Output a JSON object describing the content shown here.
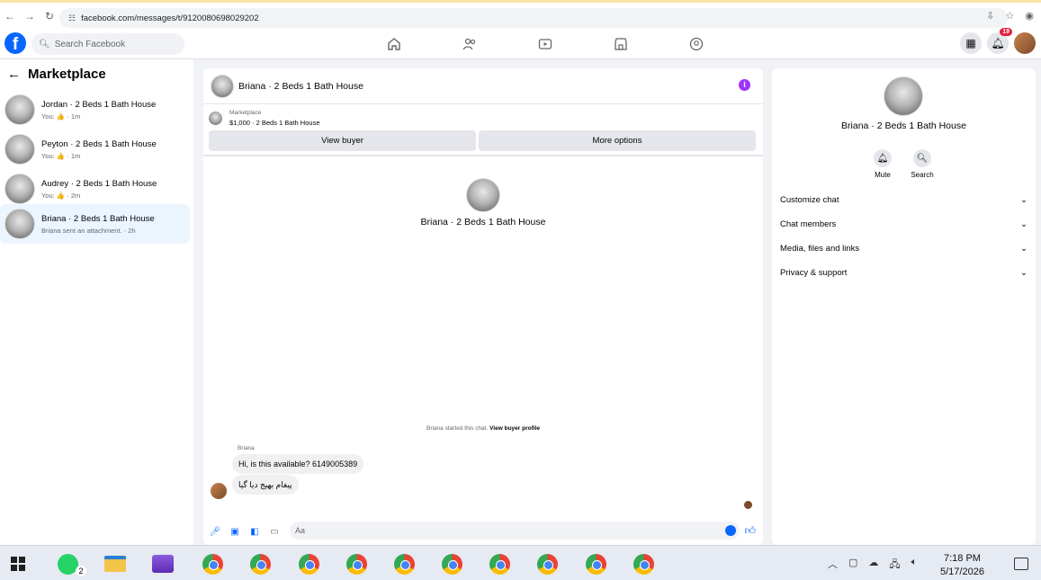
{
  "browser": {
    "url": "facebook.com/messages/t/9120080698029202",
    "tune_icon": "tune-icon"
  },
  "header": {
    "logo": "f",
    "search_placeholder": "Search Facebook",
    "notification_count": "19"
  },
  "sidebar": {
    "title": "Marketplace",
    "conversations": [
      {
        "name": "Jordan · 2 Beds 1 Bath House",
        "preview": "You: 👍 · 1m"
      },
      {
        "name": "Peyton · 2 Beds 1 Bath House",
        "preview": "You: 👍 · 1m"
      },
      {
        "name": "Audrey · 2 Beds 1 Bath House",
        "preview": "You: 👍 · 2m"
      },
      {
        "name": "Briana · 2 Beds 1 Bath House",
        "preview": "Briana sent an attachment. · 2h"
      }
    ]
  },
  "chat": {
    "header_name": "Briana · 2 Beds 1 Bath House",
    "listing_label": "Marketplace",
    "listing_desc": "$1,000 · 2 Beds 1 Bath House",
    "view_buyer_label": "View buyer",
    "more_options_label": "More options",
    "center_name": "Briana · 2 Beds 1 Bath House",
    "started_text": "Briana started this chat.",
    "view_profile_link": "View buyer profile",
    "sender": "Briana",
    "messages": [
      {
        "text": "Hi, is this available? 6149005389"
      },
      {
        "text": "پیغام بھیج دیا گیا"
      }
    ],
    "composer_placeholder": "Aa"
  },
  "details": {
    "name": "Briana · 2 Beds 1 Bath House",
    "mute_label": "Mute",
    "search_label": "Search",
    "sections": [
      "Customize chat",
      "Chat members",
      "Media, files and links",
      "Privacy & support"
    ]
  },
  "taskbar": {
    "whatsapp_count": "2",
    "time": "7:18 PM",
    "date": "5/17/2026"
  },
  "colors": {
    "accent": "#0866ff",
    "active_row": "#ebf5ff",
    "info": "#a033ff"
  }
}
